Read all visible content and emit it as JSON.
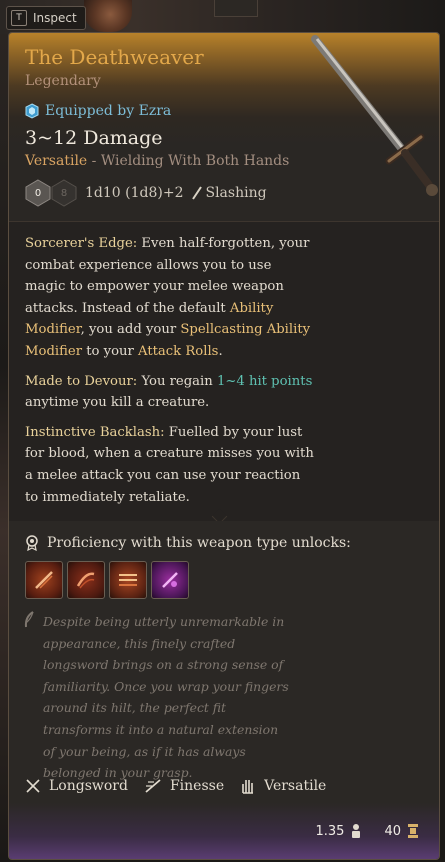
{
  "topbar": {
    "inspect_key": "T",
    "inspect_label": "Inspect"
  },
  "item": {
    "name": "The Deathweaver",
    "rarity": "Legendary",
    "equipped": "Equipped by Ezra",
    "damage": "3~12 Damage",
    "versatile_key": "Versatile",
    "versatile_text": " - Wielding With Both Hands",
    "dice": [
      "0",
      "8"
    ],
    "damage_formula": "1d10 (1d8)+2",
    "damage_type": "Slashing"
  },
  "description": {
    "p1_title": "Sorcerer's Edge:",
    "p1_a": " Even half-forgotten, your combat experience allows you to use magic to empower your melee weapon attacks. Instead of the default ",
    "p1_link1": "Ability Modifier",
    "p1_b": ", you add your ",
    "p1_link2": "Spellcasting Ability Modifier",
    "p1_c": " to your ",
    "p1_link3": "Attack Rolls",
    "p1_d": ".",
    "p2_title": "Made to Devour:",
    "p2_a": " You regain ",
    "p2_link": "1~4 hit points",
    "p2_b": " anytime you kill a creature.",
    "p3_title": "Instinctive Backlash:",
    "p3_a": " Fuelled by your lust for blood, when a creature misses you with a melee attack you can use your reaction to immediately retaliate."
  },
  "proficiency": {
    "label": "Proficiency with this weapon type unlocks:",
    "action_icons": [
      "cleave-action-icon",
      "lacerate-action-icon",
      "pommel-strike-action-icon",
      "bleed-action-icon"
    ]
  },
  "flavor": "Despite being utterly unremarkable in appearance, this finely crafted longsword brings on a strong sense of familiarity. Once you wrap your fingers around its hilt, the perfect fit transforms it into a natural extension of your being, as if it has always belonged in your grasp.",
  "tags": {
    "type": "Longsword",
    "finesse": "Finesse",
    "versatile": "Versatile"
  },
  "stats": {
    "weight": "1.35",
    "value": "40"
  },
  "colors": {
    "title": "#e3a84a",
    "equipped": "#7dbdd8",
    "keyword": "#e9d29b",
    "heal": "#5fc2b2"
  }
}
